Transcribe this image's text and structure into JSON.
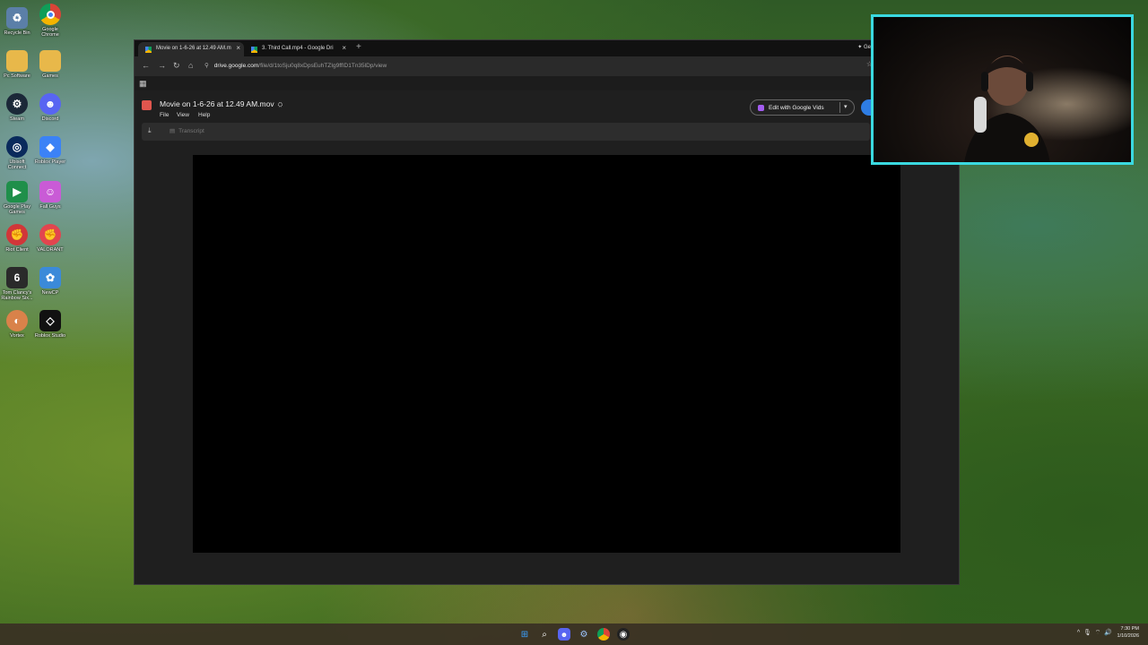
{
  "desktop": {
    "icons": [
      {
        "label": "Recycle Bin",
        "icon": "recycle-bin-icon",
        "color": "#5b7fa8"
      },
      {
        "label": "Google Chrome",
        "icon": "chrome-icon",
        "color": "#db4437"
      },
      {
        "label": "Pc Software",
        "icon": "folder-icon",
        "color": "#e8b84a"
      },
      {
        "label": "Games",
        "icon": "folder-icon",
        "color": "#e8b84a"
      },
      {
        "label": "Steam",
        "icon": "steam-icon",
        "color": "#1b2838"
      },
      {
        "label": "Discord",
        "icon": "discord-icon",
        "color": "#5865f2"
      },
      {
        "label": "Ubisoft Connect",
        "icon": "ubisoft-icon",
        "color": "#0a2a5c"
      },
      {
        "label": "Roblox Player",
        "icon": "roblox-player-icon",
        "color": "#3b82f6"
      },
      {
        "label": "Google Play Games",
        "icon": "google-play-games-icon",
        "color": "#1f8f4a"
      },
      {
        "label": "Fall Guys",
        "icon": "fall-guys-icon",
        "color": "#c95bd6"
      },
      {
        "label": "Riot Client",
        "icon": "riot-client-icon",
        "color": "#d13639"
      },
      {
        "label": "VALORANT",
        "icon": "valorant-icon",
        "color": "#e2454f"
      },
      {
        "label": "Tom Clancy's Rainbow Six...",
        "icon": "rainbow-six-icon",
        "color": "#2a2a2a"
      },
      {
        "label": "NewCP",
        "icon": "newcp-icon",
        "color": "#3b8ad9"
      },
      {
        "label": "Vortex",
        "icon": "vortex-icon",
        "color": "#d9824a"
      },
      {
        "label": "Roblox Studio",
        "icon": "roblox-studio-icon",
        "color": "#111111"
      }
    ]
  },
  "browser": {
    "tabs": [
      {
        "label": "Movie on 1-6-26 at 12.49 AM.m",
        "active": true
      },
      {
        "label": "3. Third Call.mp4 - Google Dri",
        "active": false
      }
    ],
    "new_tab": "+",
    "tab_extra": "Ge",
    "url_host": "drive.google.com",
    "url_path": "/file/d/1toSju0q8xDpsEuhTZIg9ffID1Tn35lDp/view"
  },
  "drive": {
    "title": "Movie on 1-6-26 at 12.49 AM.mov",
    "menu": [
      "File",
      "View",
      "Help"
    ],
    "edit_button": "Edit with Google Vids",
    "transcript_label": "Transcript"
  },
  "taskbar": {
    "time": "7:30 PM",
    "date": "1/10/2026"
  },
  "colors": {
    "webcam_border": "#3ad9e0",
    "vids_accent": "#a35cf0",
    "share_blue": "#2e7de4"
  }
}
